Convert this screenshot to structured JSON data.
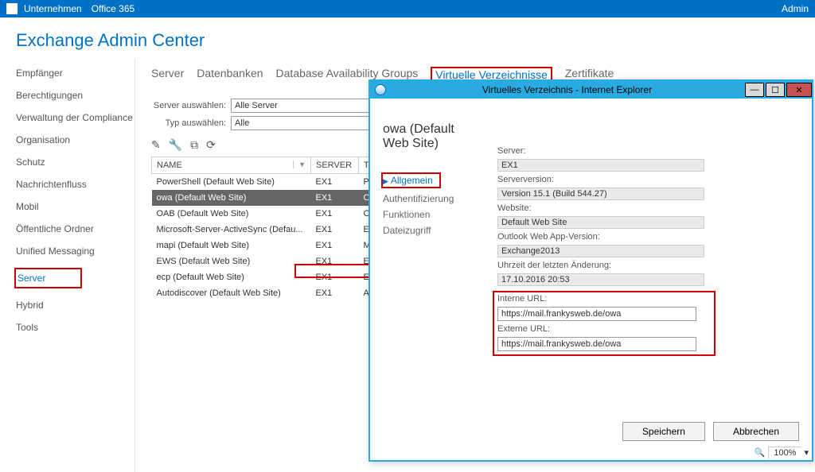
{
  "topbar": {
    "company": "Unternehmen",
    "product": "Office 365",
    "admin": "Admin"
  },
  "page_title": "Exchange Admin Center",
  "sidebar": {
    "items": [
      "Empfänger",
      "Berechtigungen",
      "Verwaltung der Compliance",
      "Organisation",
      "Schutz",
      "Nachrichtenfluss",
      "Mobil",
      "Öffentliche Ordner",
      "Unified Messaging",
      "Server",
      "Hybrid",
      "Tools"
    ]
  },
  "tabs": [
    "Server",
    "Datenbanken",
    "Database Availability Groups",
    "Virtuelle Verzeichnisse",
    "Zertifikate"
  ],
  "filters": {
    "server_label": "Server auswählen:",
    "server_value": "Alle Server",
    "type_label": "Typ auswählen:",
    "type_value": "Alle"
  },
  "table": {
    "headers": [
      "NAME",
      "SERVER",
      "TYP"
    ],
    "rows": [
      {
        "name": "PowerShell (Default Web Site)",
        "server": "EX1",
        "type": "Pow"
      },
      {
        "name": "owa (Default Web Site)",
        "server": "EX1",
        "type": "OW"
      },
      {
        "name": "OAB (Default Web Site)",
        "server": "EX1",
        "type": "OAB"
      },
      {
        "name": "Microsoft-Server-ActiveSync (Defau...",
        "server": "EX1",
        "type": "EAS"
      },
      {
        "name": "mapi (Default Web Site)",
        "server": "EX1",
        "type": "Map"
      },
      {
        "name": "EWS (Default Web Site)",
        "server": "EX1",
        "type": "EWS"
      },
      {
        "name": "ecp (Default Web Site)",
        "server": "EX1",
        "type": "ECP"
      },
      {
        "name": "Autodiscover (Default Web Site)",
        "server": "EX1",
        "type": "Aut"
      }
    ]
  },
  "popup": {
    "window_title": "Virtuelles Verzeichnis - Internet Explorer",
    "heading": "owa (Default Web Site)",
    "nav": [
      "Allgemein",
      "Authentifizierung",
      "Funktionen",
      "Dateizugriff"
    ],
    "fields": {
      "server_lbl": "Server:",
      "server_val": "EX1",
      "ver_lbl": "Serverversion:",
      "ver_val": "Version 15.1 (Build 544.27)",
      "site_lbl": "Website:",
      "site_val": "Default Web Site",
      "owa_lbl": "Outlook Web App-Version:",
      "owa_val": "Exchange2013",
      "time_lbl": "Uhrzeit der letzten Änderung:",
      "time_val": "17.10.2016 20:53",
      "inturl_lbl": "Interne URL:",
      "inturl_val": "https://mail.frankysweb.de/owa",
      "exturl_lbl": "Externe URL:",
      "exturl_val": "https://mail.frankysweb.de/owa"
    },
    "save": "Speichern",
    "cancel": "Abbrechen",
    "zoom": "100%"
  }
}
